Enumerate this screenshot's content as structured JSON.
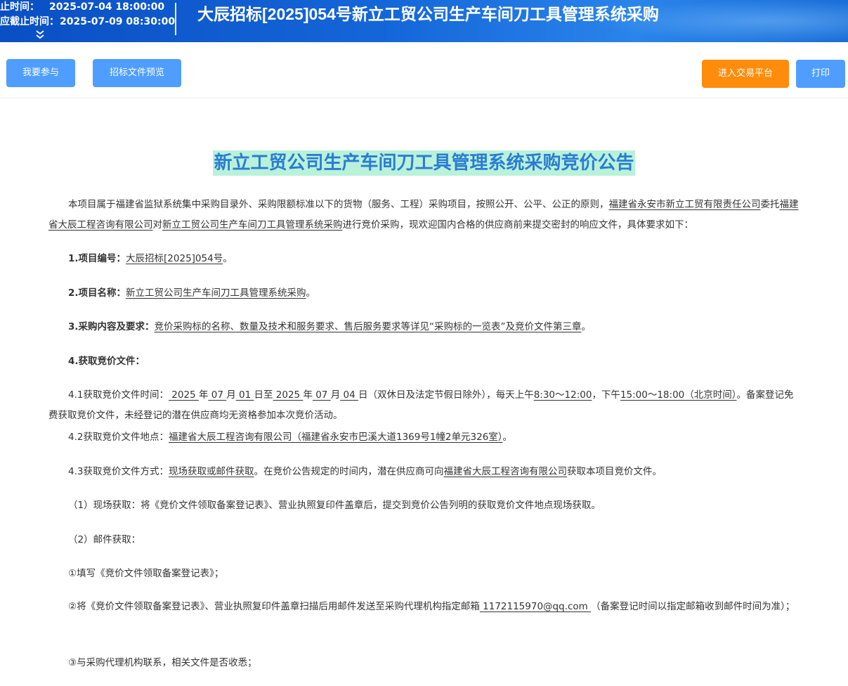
{
  "header": {
    "time_row1_label": "截止时间：",
    "time_row1_value": "2025-07-04 18:00:00",
    "time_row2_label": "响应截止时间：",
    "time_row2_value": "2025-07-09 08:30:00",
    "expand_icon": "double-chevron-down-icon",
    "title": "大辰招标[2025]054号新立工贸公司生产车间刀工具管理系统采购"
  },
  "toolbar": {
    "join_label": "我要参与",
    "preview_label": "招标文件预览",
    "platform_label": "进入交易平台",
    "print_label": "打印"
  },
  "colors": {
    "banner": "#1466d8",
    "button_blue": "#4f9eff",
    "button_orange": "#ff8c0a",
    "title_highlight": "#b9f2d9",
    "title_text": "#2a7cd6"
  },
  "document": {
    "title": "新立工贸公司生产车间刀工具管理系统采购竞价公告",
    "intro": {
      "t1": "本项目属于福建省监狱系统集中采购目录外、采购限额标准以下的货物（服务、工程）采购项目，按照公开、公平、公正的原则，",
      "u1": "福建省永安市新立工贸有限责任公司",
      "t2": "委托",
      "u2": "福建省大辰工程咨询有限公司",
      "t3": "对",
      "u3": "新立工贸公司生产车间刀工具管理系统采购",
      "t4": "进行竞价采购，现欢迎国内合格的供应商前来提交密封的响应文件，具体要求如下："
    },
    "item1": {
      "label": "1.项目编号：",
      "value": "大辰招标[2025]054号",
      "end": "。"
    },
    "item2": {
      "label": "2.项目名称：",
      "value": "新立工贸公司生产车间刀工具管理系统采购",
      "end": "。"
    },
    "item3": {
      "label": "3.采购内容及要求：",
      "value": "竞价采购标的名称、数量及技术和服务要求、售后服务要求等详见“采购标的一览表”及竞价文件第三章",
      "end": "。"
    },
    "item4": {
      "label": "4.获取竞价文件："
    },
    "s41": {
      "t1": "4.1获取竞价文件时间：",
      "y1": " 2025 ",
      "n1": "年",
      "m1": " 07 ",
      "n2": "月",
      "d1": " 01 ",
      "n3": "日至",
      "y2": " 2025 ",
      "n4": "年",
      "m2": " 07 ",
      "n5": "月",
      "d2": " 04 ",
      "n6": "日（双休日及法定节假日除外），每天上午",
      "am": "8:30～12:00",
      "n7": "，下午",
      "pm": "15:00～18:00（北京时间）",
      "t2": "。备案登记免费获取竞价文件，未经登记的潜在供应商均无资格参加本次竞价活动。"
    },
    "s42": {
      "t1": "4.2获取竞价文件地点：",
      "u1": "福建省大辰工程咨询有限公司（福建省永安市巴溪大道1369号1幢2单元326室）",
      "t2": "。"
    },
    "s43": {
      "t1": "4.3获取竞价文件方式：",
      "u1": "现场获取或邮件获取",
      "t2": "。在竞价公告规定的时间内，潜在供应商可向",
      "u2": "福建省大辰工程咨询有限公司",
      "t3": "获取本项目竞价文件。"
    },
    "p1": "（1）现场获取：将《竞价文件领取备案登记表》、营业执照复印件盖章后，提交到竞价公告列明的获取竞价文件地点现场获取。",
    "p2": "（2）邮件获取：",
    "p3": "①填写《竞价文件领取备案登记表》；",
    "p4": {
      "t1": "②将《竞价文件领取备案登记表》、营业执照复印件盖章扫描后用邮件发送至采购代理机构指定邮箱",
      "u1": " 1172115970@qq.com ",
      "t2": "（备案登记时间以指定邮箱收到邮件时间为准）；"
    },
    "p5": "③与采购代理机构联系，相关文件是否收悉；"
  }
}
